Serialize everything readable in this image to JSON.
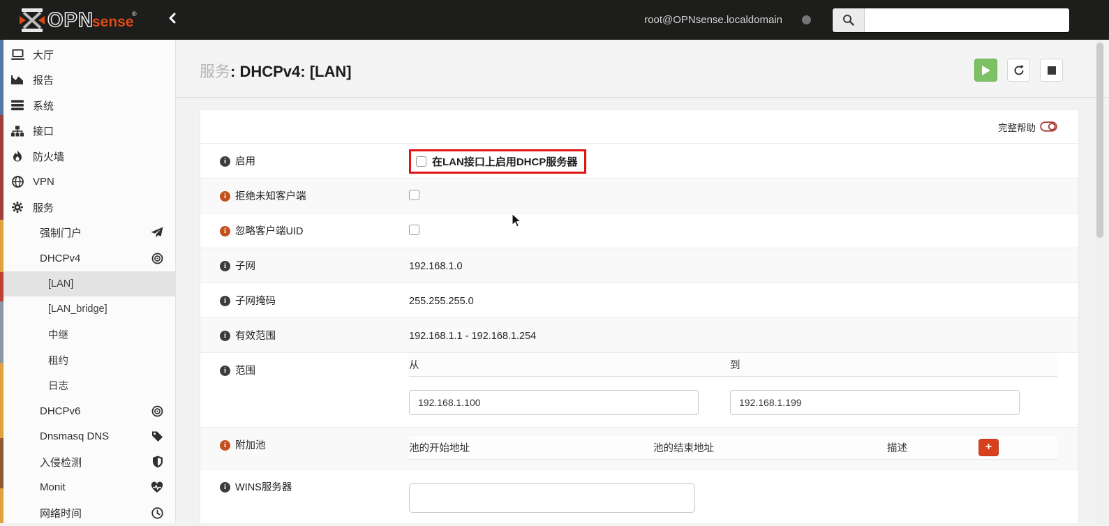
{
  "colors": {
    "accent_orange": "#d9411e",
    "highlight_red": "#e31212",
    "play_green": "#7cc163",
    "topbar_bg": "#1d1d1c"
  },
  "icons": {
    "brand": "opnsense-hourglass-icon",
    "collapse": "chevron-left-icon",
    "search": "magnifier-icon",
    "help_toggle": "toggle-off-icon",
    "info": "info-circle-icon",
    "play": "play-icon",
    "refresh": "refresh-icon",
    "stop": "stop-square-icon",
    "add": "plus-icon",
    "pointer": "mouse-cursor-icon"
  },
  "topbar": {
    "brand_opn": "OPN",
    "brand_sense": "sense",
    "registered": "®",
    "user": "root@OPNsense.localdomain",
    "search_placeholder": ""
  },
  "sidebar": {
    "items": [
      {
        "label": "大厅",
        "icon": "desktop-icon",
        "level": 0
      },
      {
        "label": "报告",
        "icon": "area-chart-icon",
        "level": 0
      },
      {
        "label": "系统",
        "icon": "server-icon",
        "level": 0
      },
      {
        "label": "接口",
        "icon": "sitemap-icon",
        "level": 0
      },
      {
        "label": "防火墙",
        "icon": "fire-icon",
        "level": 0
      },
      {
        "label": "VPN",
        "icon": "globe-icon",
        "level": 0
      },
      {
        "label": "服务",
        "icon": "gear-icon",
        "level": 0
      },
      {
        "label": "强制门户",
        "right_icon": "paper-plane-icon",
        "level": 1
      },
      {
        "label": "DHCPv4",
        "right_icon": "bullseye-icon",
        "level": 1
      },
      {
        "label": "[LAN]",
        "level": 2,
        "active": true
      },
      {
        "label": "[LAN_bridge]",
        "level": 2
      },
      {
        "label": "中继",
        "level": 2
      },
      {
        "label": "租约",
        "level": 2
      },
      {
        "label": "日志",
        "level": 2
      },
      {
        "label": "DHCPv6",
        "right_icon": "bullseye-icon",
        "level": 1
      },
      {
        "label": "Dnsmasq DNS",
        "right_icon": "tag-icon",
        "level": 1
      },
      {
        "label": "入侵检测",
        "right_icon": "shield-icon",
        "level": 1
      },
      {
        "label": "Monit",
        "right_icon": "heartbeat-icon",
        "level": 1
      },
      {
        "label": "网络时间",
        "right_icon": "clock-icon",
        "level": 1
      }
    ]
  },
  "page": {
    "title_prefix": "服务",
    "title_rest": ": DHCPv4: [LAN]"
  },
  "form": {
    "full_help_label": "完整帮助",
    "enable": {
      "label": "启用",
      "checkbox_label": "在LAN接口上启用DHCP服务器",
      "checked": false
    },
    "deny": {
      "label": "拒绝未知客户端",
      "checked": false
    },
    "uid": {
      "label": "忽略客户端UID",
      "checked": false
    },
    "subnet": {
      "label": "子网",
      "value": "192.168.1.0"
    },
    "mask": {
      "label": "子网掩码",
      "value": "255.255.255.0"
    },
    "avail": {
      "label": "有效范围",
      "value": "192.168.1.1 - 192.168.1.254"
    },
    "range": {
      "label": "范围",
      "from_header": "从",
      "to_header": "到",
      "from_value": "192.168.1.100",
      "to_value": "192.168.1.199"
    },
    "pools": {
      "label": "附加池",
      "col_start": "池的开始地址",
      "col_end": "池的结束地址",
      "col_desc": "描述",
      "add_label": "+"
    },
    "wins": {
      "label": "WINS服务器",
      "value": ""
    }
  }
}
